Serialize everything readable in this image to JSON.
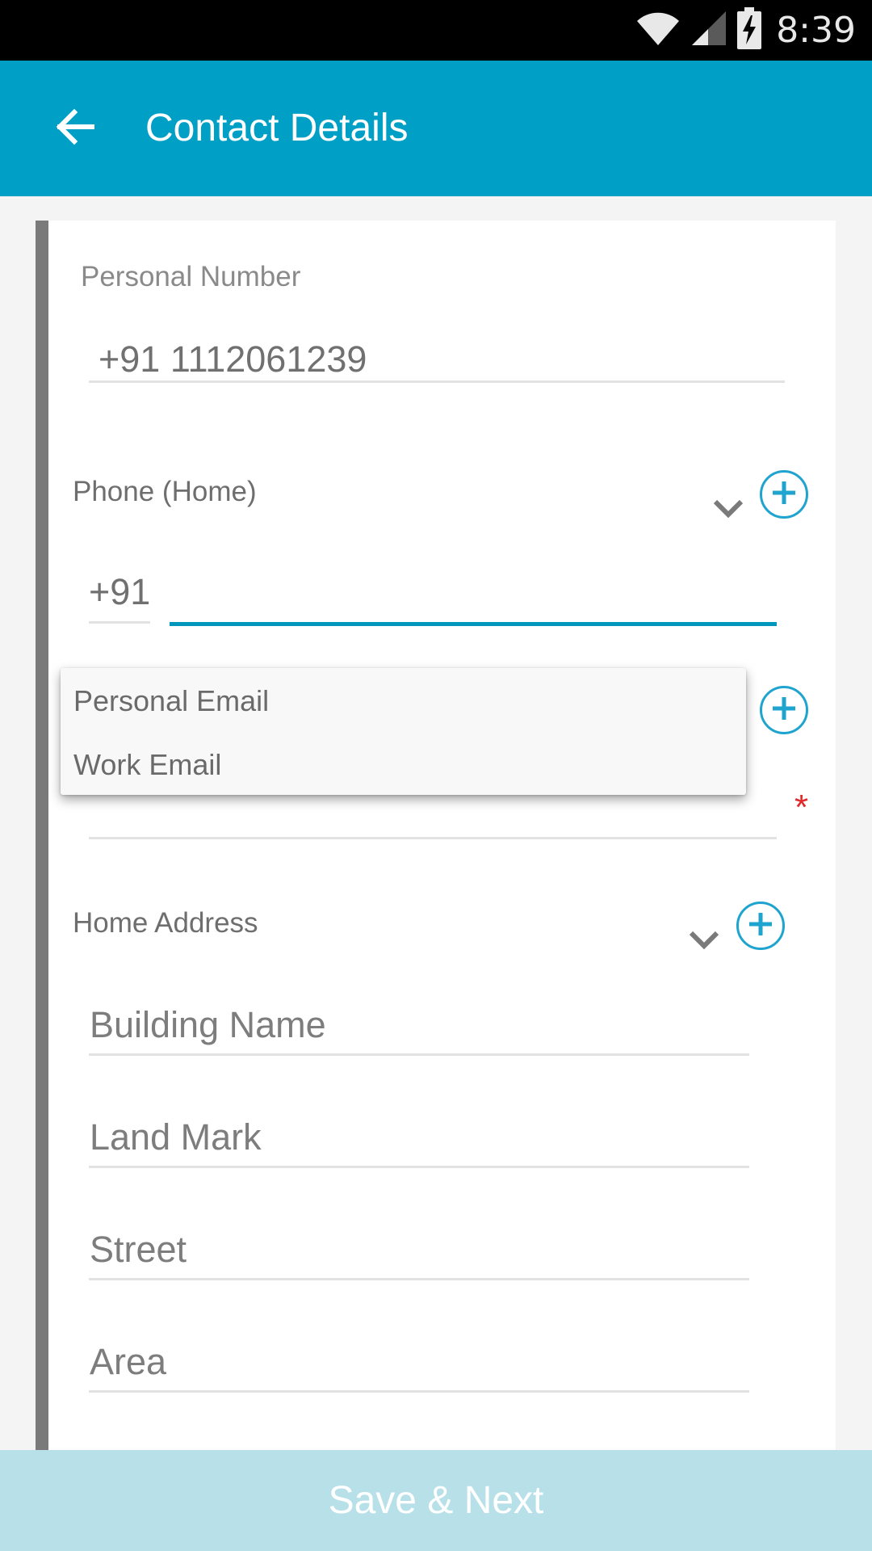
{
  "status_bar": {
    "time": "8:39",
    "icons": [
      "wifi-icon",
      "signal-icon",
      "battery-charging-icon"
    ]
  },
  "app_bar": {
    "title": "Contact Details",
    "back_icon": "arrow-back-icon",
    "color": "#00a0c6"
  },
  "form": {
    "personal_number": {
      "label": "Personal Number",
      "value": "+91 1112061239"
    },
    "phone_home": {
      "label": "Phone (Home)",
      "country_code": "+91",
      "value": ""
    },
    "email": {
      "required_mark": "*",
      "options": [
        "Personal Email",
        "Work Email"
      ]
    },
    "home_address": {
      "label": "Home Address",
      "building_placeholder": "Building Name",
      "landmark_placeholder": "Land Mark",
      "street_placeholder": "Street",
      "area_placeholder": "Area"
    }
  },
  "footer": {
    "save_label": "Save & Next"
  },
  "colors": {
    "accent": "#0097bd",
    "required": "#e02a2a",
    "save_bar": "#b8e0e8"
  }
}
